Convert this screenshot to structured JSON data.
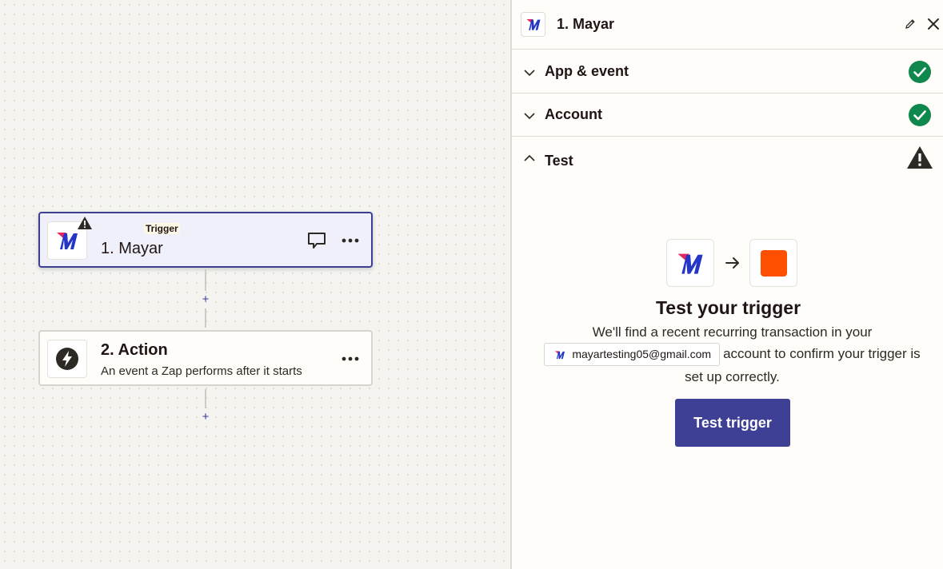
{
  "canvas": {
    "trigger_step": {
      "tag": "Trigger",
      "title": "1. Mayar",
      "app_icon": "mayar-logo",
      "warning_icon": "warning-icon",
      "comment_icon": "comment-icon",
      "more_icon": "more-horizontal-icon"
    },
    "action_step": {
      "title": "2. Action",
      "subtitle": "An event a Zap performs after it starts",
      "app_icon": "lightning-icon",
      "more_icon": "more-horizontal-icon"
    },
    "add_step_label": "+"
  },
  "panel": {
    "title": "1. Mayar",
    "sections": [
      {
        "label": "App & event",
        "state": "collapsed",
        "status": "complete"
      },
      {
        "label": "Account",
        "state": "collapsed",
        "status": "complete"
      },
      {
        "label": "Test",
        "state": "expanded",
        "status": "warning"
      }
    ],
    "test": {
      "heading": "Test your trigger",
      "desc_before": "We'll find a recent recurring transaction in your",
      "account_email": "mayartesting05@gmail.com",
      "desc_after": "account to confirm your trigger is set up correctly.",
      "button_label": "Test trigger"
    }
  },
  "colors": {
    "accent": "#3d4094",
    "success": "#0f884e",
    "warning": "#2d2a26",
    "trigger_placeholder": "#ff4f00",
    "mayar_blue": "#2436c8",
    "mayar_pink": "#e8265e"
  }
}
